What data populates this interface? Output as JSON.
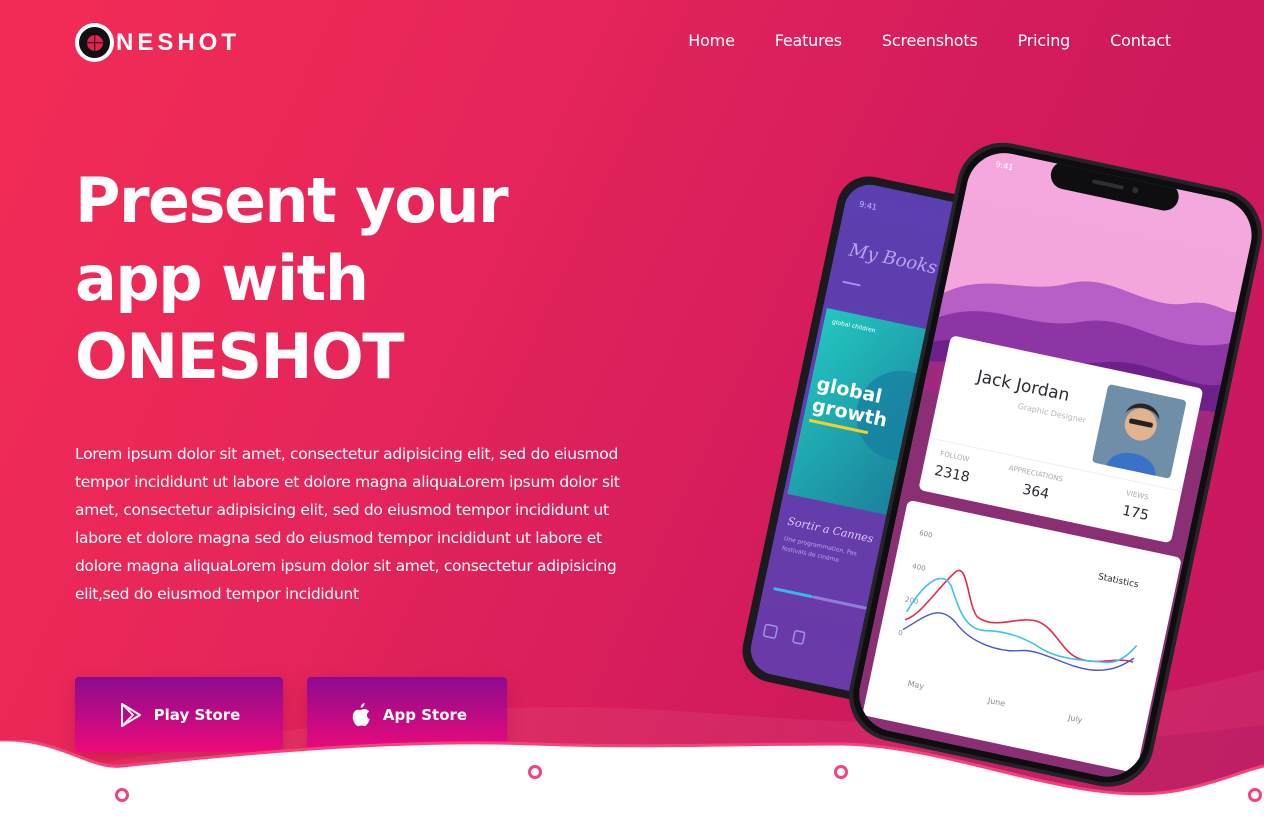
{
  "brand": {
    "logo_text": "NESHOT",
    "logo_icon": "target-logo-icon"
  },
  "nav": {
    "items": [
      {
        "label": "Home"
      },
      {
        "label": "Features"
      },
      {
        "label": "Screenshots"
      },
      {
        "label": "Pricing"
      },
      {
        "label": "Contact"
      }
    ]
  },
  "hero": {
    "title_lines": [
      "Present your",
      "app with",
      "ONESHOT"
    ],
    "description": "Lorem ipsum dolor sit amet, consectetur adipisicing elit, sed do eiusmod tempor incididunt ut labore et dolore magna aliquaLorem ipsum dolor sit amet, consectetur adipisicing elit, sed do eiusmod tempor incididunt ut labore et dolore magna sed do eiusmod tempor incididunt ut labore et dolore magna aliquaLorem ipsum dolor sit amet, consectetur adipisicing elit,sed do eiusmod tempor incididunt",
    "play_store_label": "Play Store",
    "app_store_label": "App Store"
  },
  "phone_back": {
    "time": "9:41",
    "title": "My Books",
    "book_title_1": "global",
    "book_title_2": "growth",
    "book_tag": "global children",
    "card_title": "Sortir a Cannes",
    "card_sub_1": "Une programmation. Pas",
    "card_sub_2": "festivals de cinéma"
  },
  "phone_front": {
    "time": "9:41",
    "profile": {
      "name": "Jack Jordan",
      "role": "Graphic Designer"
    },
    "stats": [
      {
        "label": "FOLLOW",
        "value": "2318"
      },
      {
        "label": "APPRECIATIONS",
        "value": "364"
      },
      {
        "label": "VIEWS",
        "value": "175"
      }
    ],
    "chart": {
      "title": "Statistics",
      "y_ticks": [
        "600",
        "400",
        "200",
        "0"
      ],
      "x_ticks": [
        "May",
        "June",
        "July"
      ]
    }
  },
  "colors": {
    "bg_start": "#f32c55",
    "bg_end": "#c8175f",
    "button_top": "#8c0b8f",
    "button_bottom": "#ec0a7a",
    "line_red": "#e8294f",
    "line_blue": "#3cc4ea"
  }
}
